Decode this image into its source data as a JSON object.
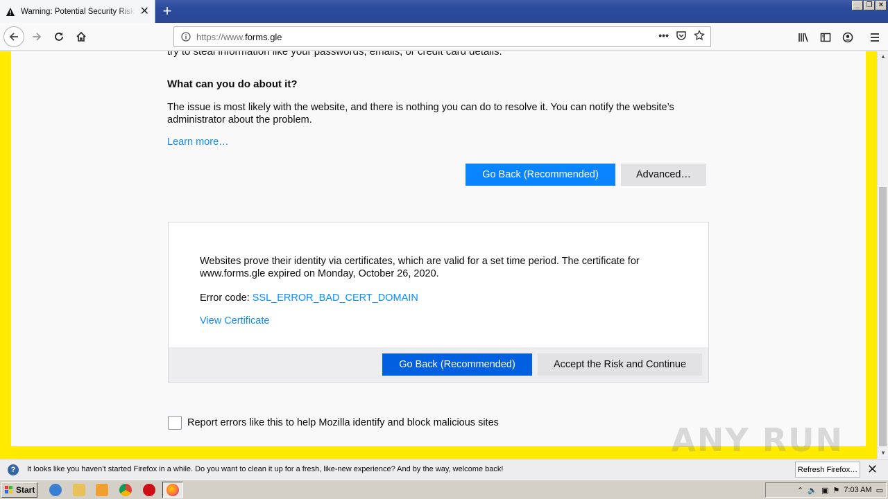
{
  "browser": {
    "tab_title": "Warning: Potential Security Risk Ahead",
    "url_prefix": "https://www.",
    "url_domain": "forms.gle"
  },
  "page": {
    "cut_text": "try to steal information like your passwords, emails, or credit card details.",
    "heading": "What can you do about it?",
    "paragraph": "The issue is most likely with the website, and there is nothing you can do to resolve it. You can notify the website’s administrator about the problem.",
    "learn_more": "Learn more…",
    "go_back_label": "Go Back (Recommended)",
    "advanced_label": "Advanced…"
  },
  "advanced": {
    "text": "Websites prove their identity via certificates, which are valid for a set time period. The certificate for www.forms.gle expired on Monday, October 26, 2020.",
    "error_code_label": "Error code: ",
    "error_code": "SSL_ERROR_BAD_CERT_DOMAIN",
    "view_certificate": "View Certificate",
    "go_back_label": "Go Back (Recommended)",
    "accept_label": "Accept the Risk and Continue"
  },
  "report": {
    "label": "Report errors like this to help Mozilla identify and block malicious sites",
    "checked": false
  },
  "watermark": "ANY RUN",
  "notification": {
    "text": "It looks like you haven’t started Firefox in a while. Do you want to clean it up for a fresh, like-new experience? And by the way, welcome back!",
    "button": "Refresh Firefox…"
  },
  "taskbar": {
    "start": "Start",
    "clock": "7:03 AM"
  },
  "colors": {
    "page_border": "#ffea00",
    "primary": "#0a84ff",
    "primary_dark": "#0060df",
    "link": "#0a8dff"
  }
}
